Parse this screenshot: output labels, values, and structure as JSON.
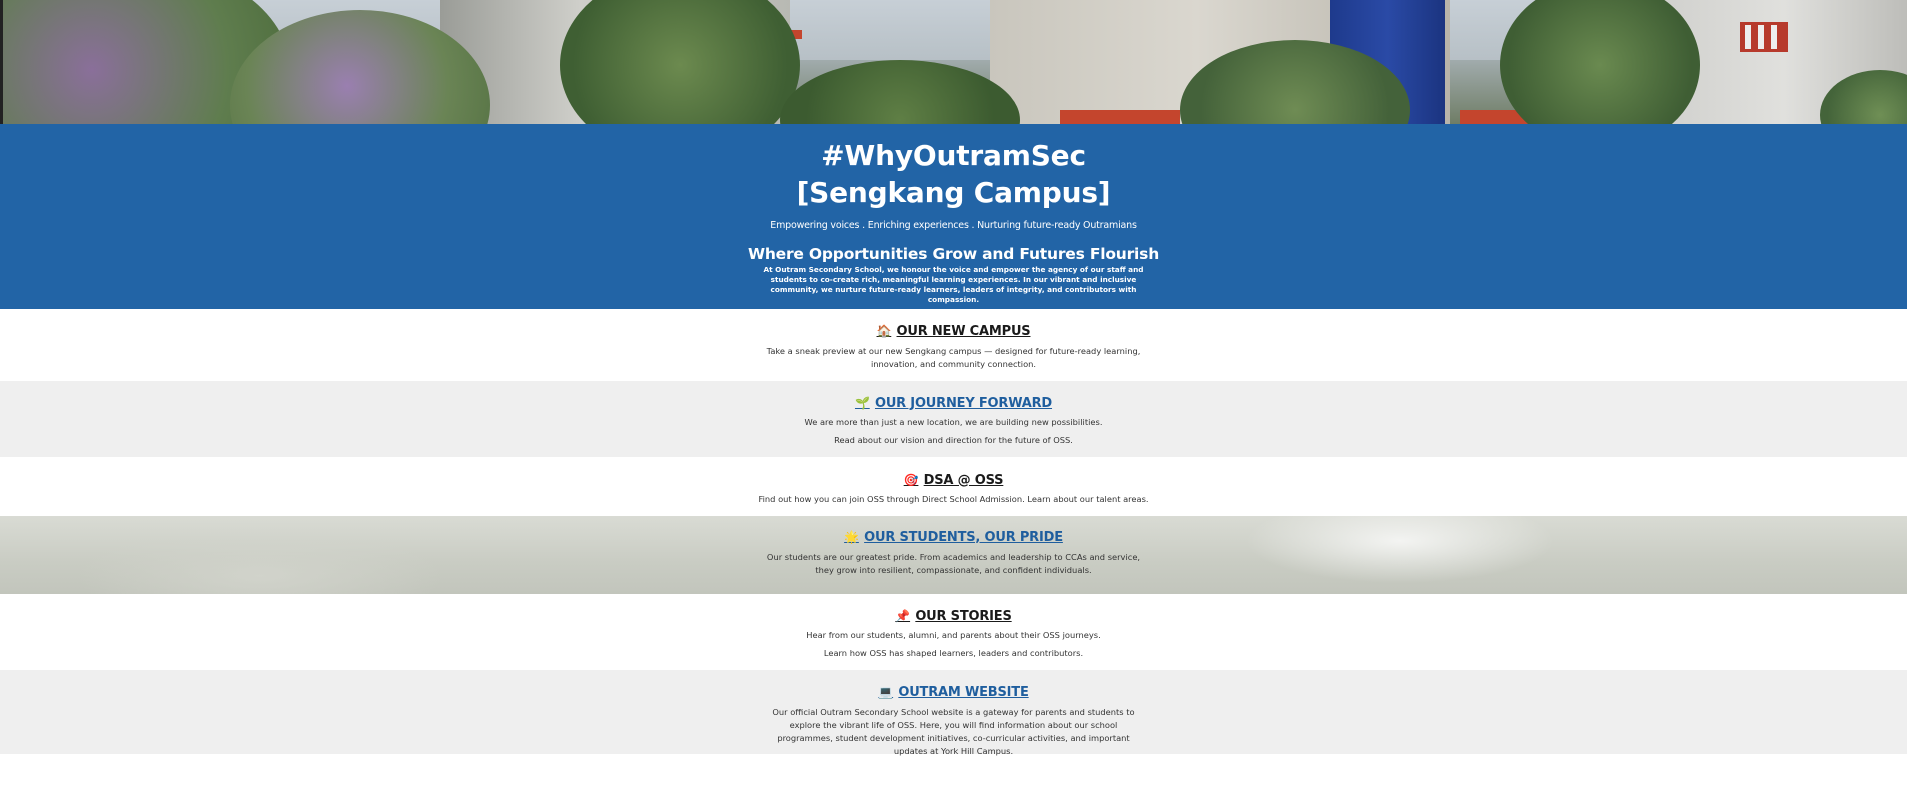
{
  "hero": {
    "image_desc_icon": "campus-photo"
  },
  "intro": {
    "title_line1": "#WhyOutramSec",
    "title_line2": "[Sengkang Campus]",
    "tagline": "Empowering voices . Enriching experiences . Nurturing future-ready Outramians",
    "heading": "Where Opportunities Grow and Futures Flourish",
    "blurb": "At Outram Secondary School, we honour the voice and empower the agency of our staff and students to co-create rich, meaningful learning experiences. In our vibrant and inclusive community, we nurture future-ready learners, leaders of integrity, and contributors with compassion."
  },
  "sections": [
    {
      "icon": "house-icon",
      "glyph": "🏠",
      "title": "OUR NEW CAMPUS",
      "lines": [
        "Take a sneak preview at our new Sengkang campus — designed for future-ready learning, innovation, and community connection."
      ]
    },
    {
      "icon": "seedling-icon",
      "glyph": "🌱",
      "title": "OUR JOURNEY FORWARD",
      "lines": [
        "We are more than just a new location, we are building new possibilities.",
        "Read about our vision and direction for the future of OSS."
      ]
    },
    {
      "icon": "target-icon",
      "glyph": "🎯",
      "title": "DSA @ OSS",
      "lines": [
        "Find out how you can join OSS through Direct School Admission. Learn about our talent areas."
      ]
    },
    {
      "icon": "sun-icon",
      "glyph": "🌟",
      "title": "OUR STUDENTS, OUR PRIDE",
      "lines": [
        "Our students are our greatest pride. From academics and leadership to CCAs and service, they grow into resilient, compassionate, and confident individuals."
      ]
    },
    {
      "icon": "pin-icon",
      "glyph": "📌",
      "title": "OUR STORIES",
      "lines": [
        "Hear from our students, alumni, and parents about their OSS journeys.",
        "Learn how OSS has shaped learners, leaders and contributors."
      ]
    },
    {
      "icon": "laptop-icon",
      "glyph": "💻",
      "title": "OUTRAM WEBSITE",
      "lines": [
        "Our official Outram Secondary School website is a gateway for parents and students to explore the vibrant life of OSS. Here, you will find information about our school programmes, student development initiatives, co-curricular activities, and important updates at York Hill Campus."
      ]
    }
  ],
  "colors": {
    "intro_bg": "#2264a6",
    "link": "#1f5e9e",
    "grey_band": "#efefef"
  }
}
